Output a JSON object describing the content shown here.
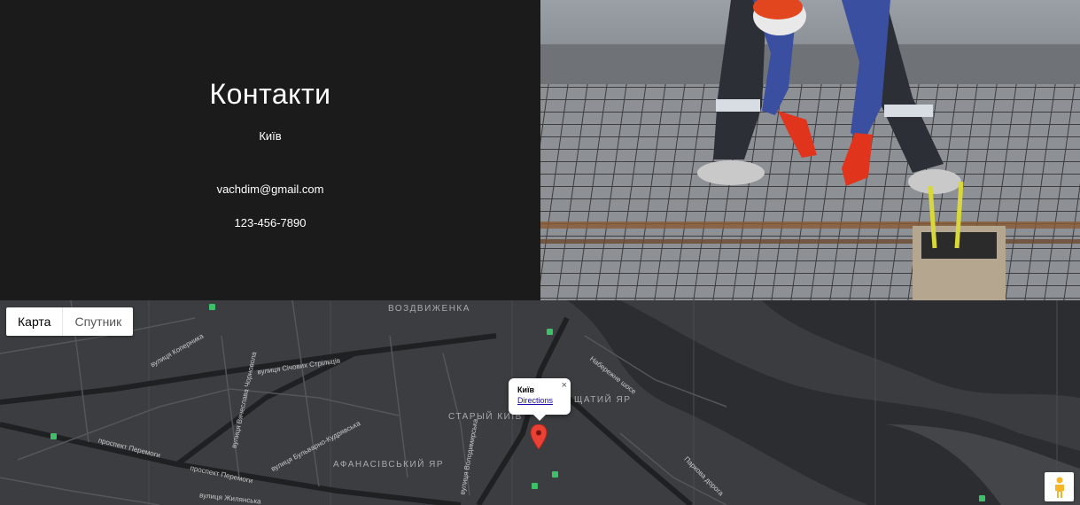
{
  "contact": {
    "title": "Контакти",
    "city": "Київ",
    "email": "vachdim@gmail.com",
    "phone": "123-456-7890"
  },
  "photo": {
    "icon": "construction-worker-image"
  },
  "map": {
    "type_control": {
      "map_label": "Карта",
      "satellite_label": "Спутник"
    },
    "streets": [
      "вулиця Коперника",
      "вулиця Січових Стрільців",
      "вулиця Вячеслава Чорновола",
      "вулиця Бульварно-Кудрявська",
      "проспект Перемоги",
      "проспект Перемоги",
      "вулиця Жилянська",
      "вулиця Володимирська",
      "Набережне шосе",
      "Паркова дорога"
    ],
    "districts": [
      "ВОЗДВИЖЕНКА",
      "СТАРЫЙ КИЇВ",
      "ЩАТИЙ ЯР",
      "АФАНАСІВСЬКИЙ ЯР"
    ],
    "info_window": {
      "title": "Київ",
      "link": "Directions",
      "close": "×"
    },
    "marker_icon": "map-pin-icon",
    "pegman_icon": "street-view-pegman-icon"
  }
}
